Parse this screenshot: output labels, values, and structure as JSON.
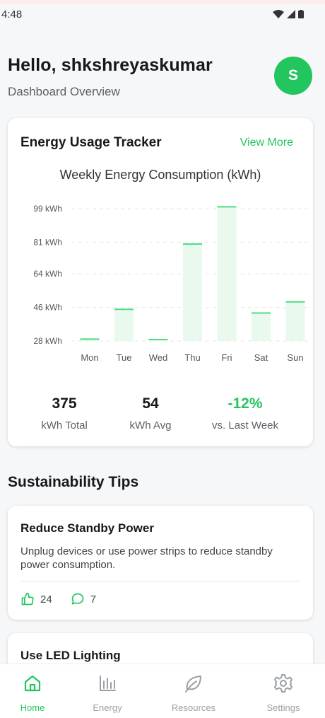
{
  "status_bar": {
    "time": "4:48"
  },
  "header": {
    "greeting": "Hello, shkshreyaskumar",
    "subtitle": "Dashboard Overview",
    "avatar_initial": "S"
  },
  "energy_card": {
    "title": "Energy Usage Tracker",
    "view_more": "View More",
    "stats": [
      {
        "value": "375",
        "label": "kWh Total"
      },
      {
        "value": "54",
        "label": "kWh Avg"
      },
      {
        "value": "-12%",
        "label": "vs. Last Week"
      }
    ]
  },
  "chart_data": {
    "type": "bar",
    "title": "Weekly Energy Consumption (kWh)",
    "categories": [
      "Mon",
      "Tue",
      "Wed",
      "Thu",
      "Fri",
      "Sat",
      "Sun"
    ],
    "values": [
      29,
      45,
      28,
      80,
      100,
      43,
      49
    ],
    "y_ticks": [
      "99 kWh",
      "81 kWh",
      "64 kWh",
      "46 kWh",
      "28 kWh"
    ],
    "y_tick_values": [
      99,
      81,
      64,
      46,
      28
    ],
    "ylim": [
      28,
      99
    ],
    "grid": true,
    "colors": {
      "fill": "#e9f9ee",
      "line": "#4ade80"
    }
  },
  "tips": {
    "title": "Sustainability Tips",
    "items": [
      {
        "title": "Reduce Standby Power",
        "description": "Unplug devices or use power strips to reduce standby power consumption.",
        "likes": "24",
        "comments": "7"
      },
      {
        "title": "Use LED Lighting"
      }
    ]
  },
  "nav": {
    "items": [
      {
        "label": "Home",
        "icon": "home-icon"
      },
      {
        "label": "Energy",
        "icon": "bar-chart-icon"
      },
      {
        "label": "Resources",
        "icon": "leaf-icon"
      },
      {
        "label": "Settings",
        "icon": "gear-icon"
      }
    ]
  },
  "colors": {
    "accent": "#22c55e",
    "text": "#15191d",
    "muted": "#5b6168",
    "background": "#f6f7f8"
  }
}
